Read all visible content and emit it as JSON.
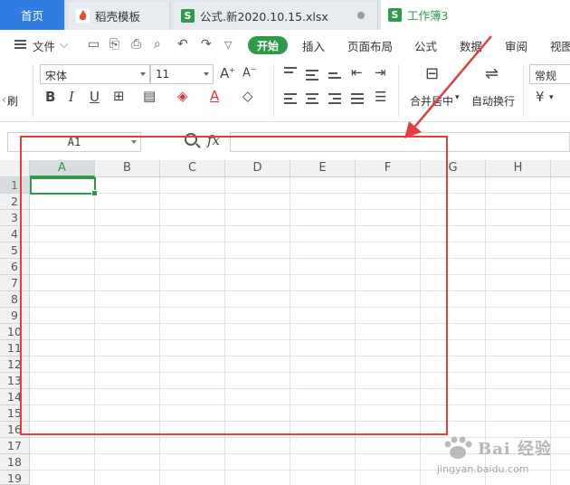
{
  "tabs": [
    {
      "label": "首页",
      "active": false
    },
    {
      "label": "稻壳模板",
      "icon": "docer-icon"
    },
    {
      "label": "公式.新2020.10.15.xlsx",
      "icon": "spreadsheet-icon"
    },
    {
      "label": "工作簿3",
      "icon": "spreadsheet-icon",
      "active": true
    }
  ],
  "menu": {
    "file": "文件",
    "start": "开始",
    "insert": "插入",
    "layout": "页面布局",
    "formula": "公式",
    "data": "数据",
    "review": "审阅",
    "view": "视图"
  },
  "ribbon": {
    "font_name": "宋体",
    "font_size": "11",
    "merge_label": "合并居中",
    "wrap_label": "自动换行",
    "number_format": "常规",
    "currency_symbol": "¥",
    "brush_label": "刷",
    "bold": "B",
    "italic": "I",
    "underline": "U"
  },
  "formula_bar": {
    "cell_ref": "A1",
    "fx": "fx",
    "value": ""
  },
  "columns": [
    "A",
    "B",
    "C",
    "D",
    "E",
    "F",
    "G",
    "H"
  ],
  "rows": [
    "1",
    "2",
    "3",
    "4",
    "5",
    "6",
    "7",
    "8",
    "9",
    "10",
    "11",
    "12",
    "13",
    "14",
    "15",
    "16",
    "17",
    "18",
    "19"
  ],
  "selected_cell": "A1",
  "colors": {
    "accent": "#2e9a4a",
    "home_tab": "#2f7de1",
    "annotation": "#e63c3c"
  },
  "watermark": {
    "text": "Bai 经验",
    "url": "jingyan.baidu.com"
  }
}
